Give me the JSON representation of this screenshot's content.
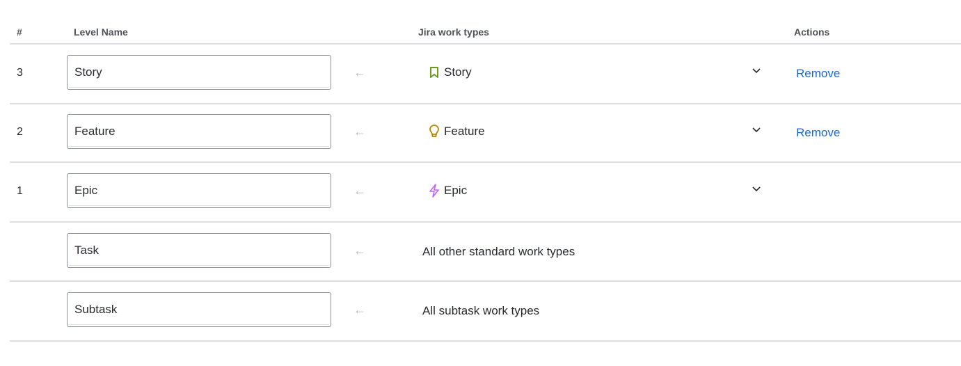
{
  "headers": {
    "num": "#",
    "level": "Level Name",
    "types": "Jira work types",
    "actions": "Actions"
  },
  "rows": [
    {
      "num": "3",
      "level": "Story",
      "type": "Story",
      "icon": "bookmark-icon",
      "color": "#6a9a23",
      "remove": "Remove"
    },
    {
      "num": "2",
      "level": "Feature",
      "type": "Feature",
      "icon": "lightbulb-icon",
      "color": "#b38600",
      "remove": "Remove"
    },
    {
      "num": "1",
      "level": "Epic",
      "type": "Epic",
      "icon": "lightning-icon",
      "color": "#bf63f3"
    },
    {
      "level": "Task",
      "plain": "All other standard work types"
    },
    {
      "level": "Subtask",
      "plain": "All subtask work types"
    }
  ],
  "arrow": "←"
}
